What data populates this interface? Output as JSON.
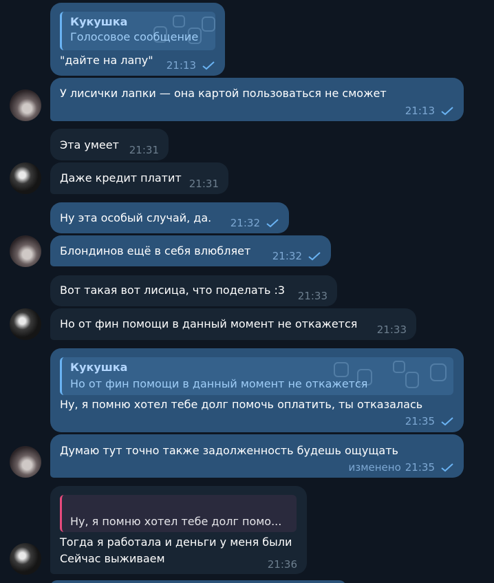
{
  "messages": [
    {
      "reply_name": "Кукушка",
      "reply_text": "Голосовое сообщение",
      "text": "\"дайте на лапу\"",
      "time": "21:13"
    },
    {
      "text": "У лисички лапки — она картой пользоваться не сможет",
      "time": "21:13"
    },
    {
      "text": "Эта умеет",
      "time": "21:31"
    },
    {
      "text": "Даже кредит платит",
      "time": "21:31"
    },
    {
      "text": "Ну эта особый случай, да.",
      "time": "21:32"
    },
    {
      "text": "Блондинов ещё в себя влюбляет",
      "time": "21:32"
    },
    {
      "text": "Вот такая вот лисица, что поделать :3",
      "time": "21:33"
    },
    {
      "text": "Но от фин помощи в данный момент не откажется",
      "time": "21:33"
    },
    {
      "reply_name": "Кукушка",
      "reply_text": "Но от фин помощи в данный момент не откажется",
      "text": "Ну, я помню хотел тебе долг помочь оплатить, ты отказалась",
      "time": "21:35"
    },
    {
      "text": "Думаю тут точно также задолженность будешь ощущать",
      "edited": "изменено",
      "time": "21:35"
    },
    {
      "reply_text": "Ну, я помню хотел тебе долг помо...",
      "line1": "Тогда я работала и деньги у меня были",
      "line2": "Сейчас выживаем",
      "time": "21:36"
    }
  ],
  "colors": {
    "background": "#0e1621",
    "outgoing_bubble": "#2b5278",
    "incoming_bubble": "#182533",
    "check": "#6ab3f3",
    "reply_accent_out": "#6ab3f3",
    "reply_accent_in": "#e84a7d"
  },
  "icons": {
    "read": "check-icon"
  }
}
